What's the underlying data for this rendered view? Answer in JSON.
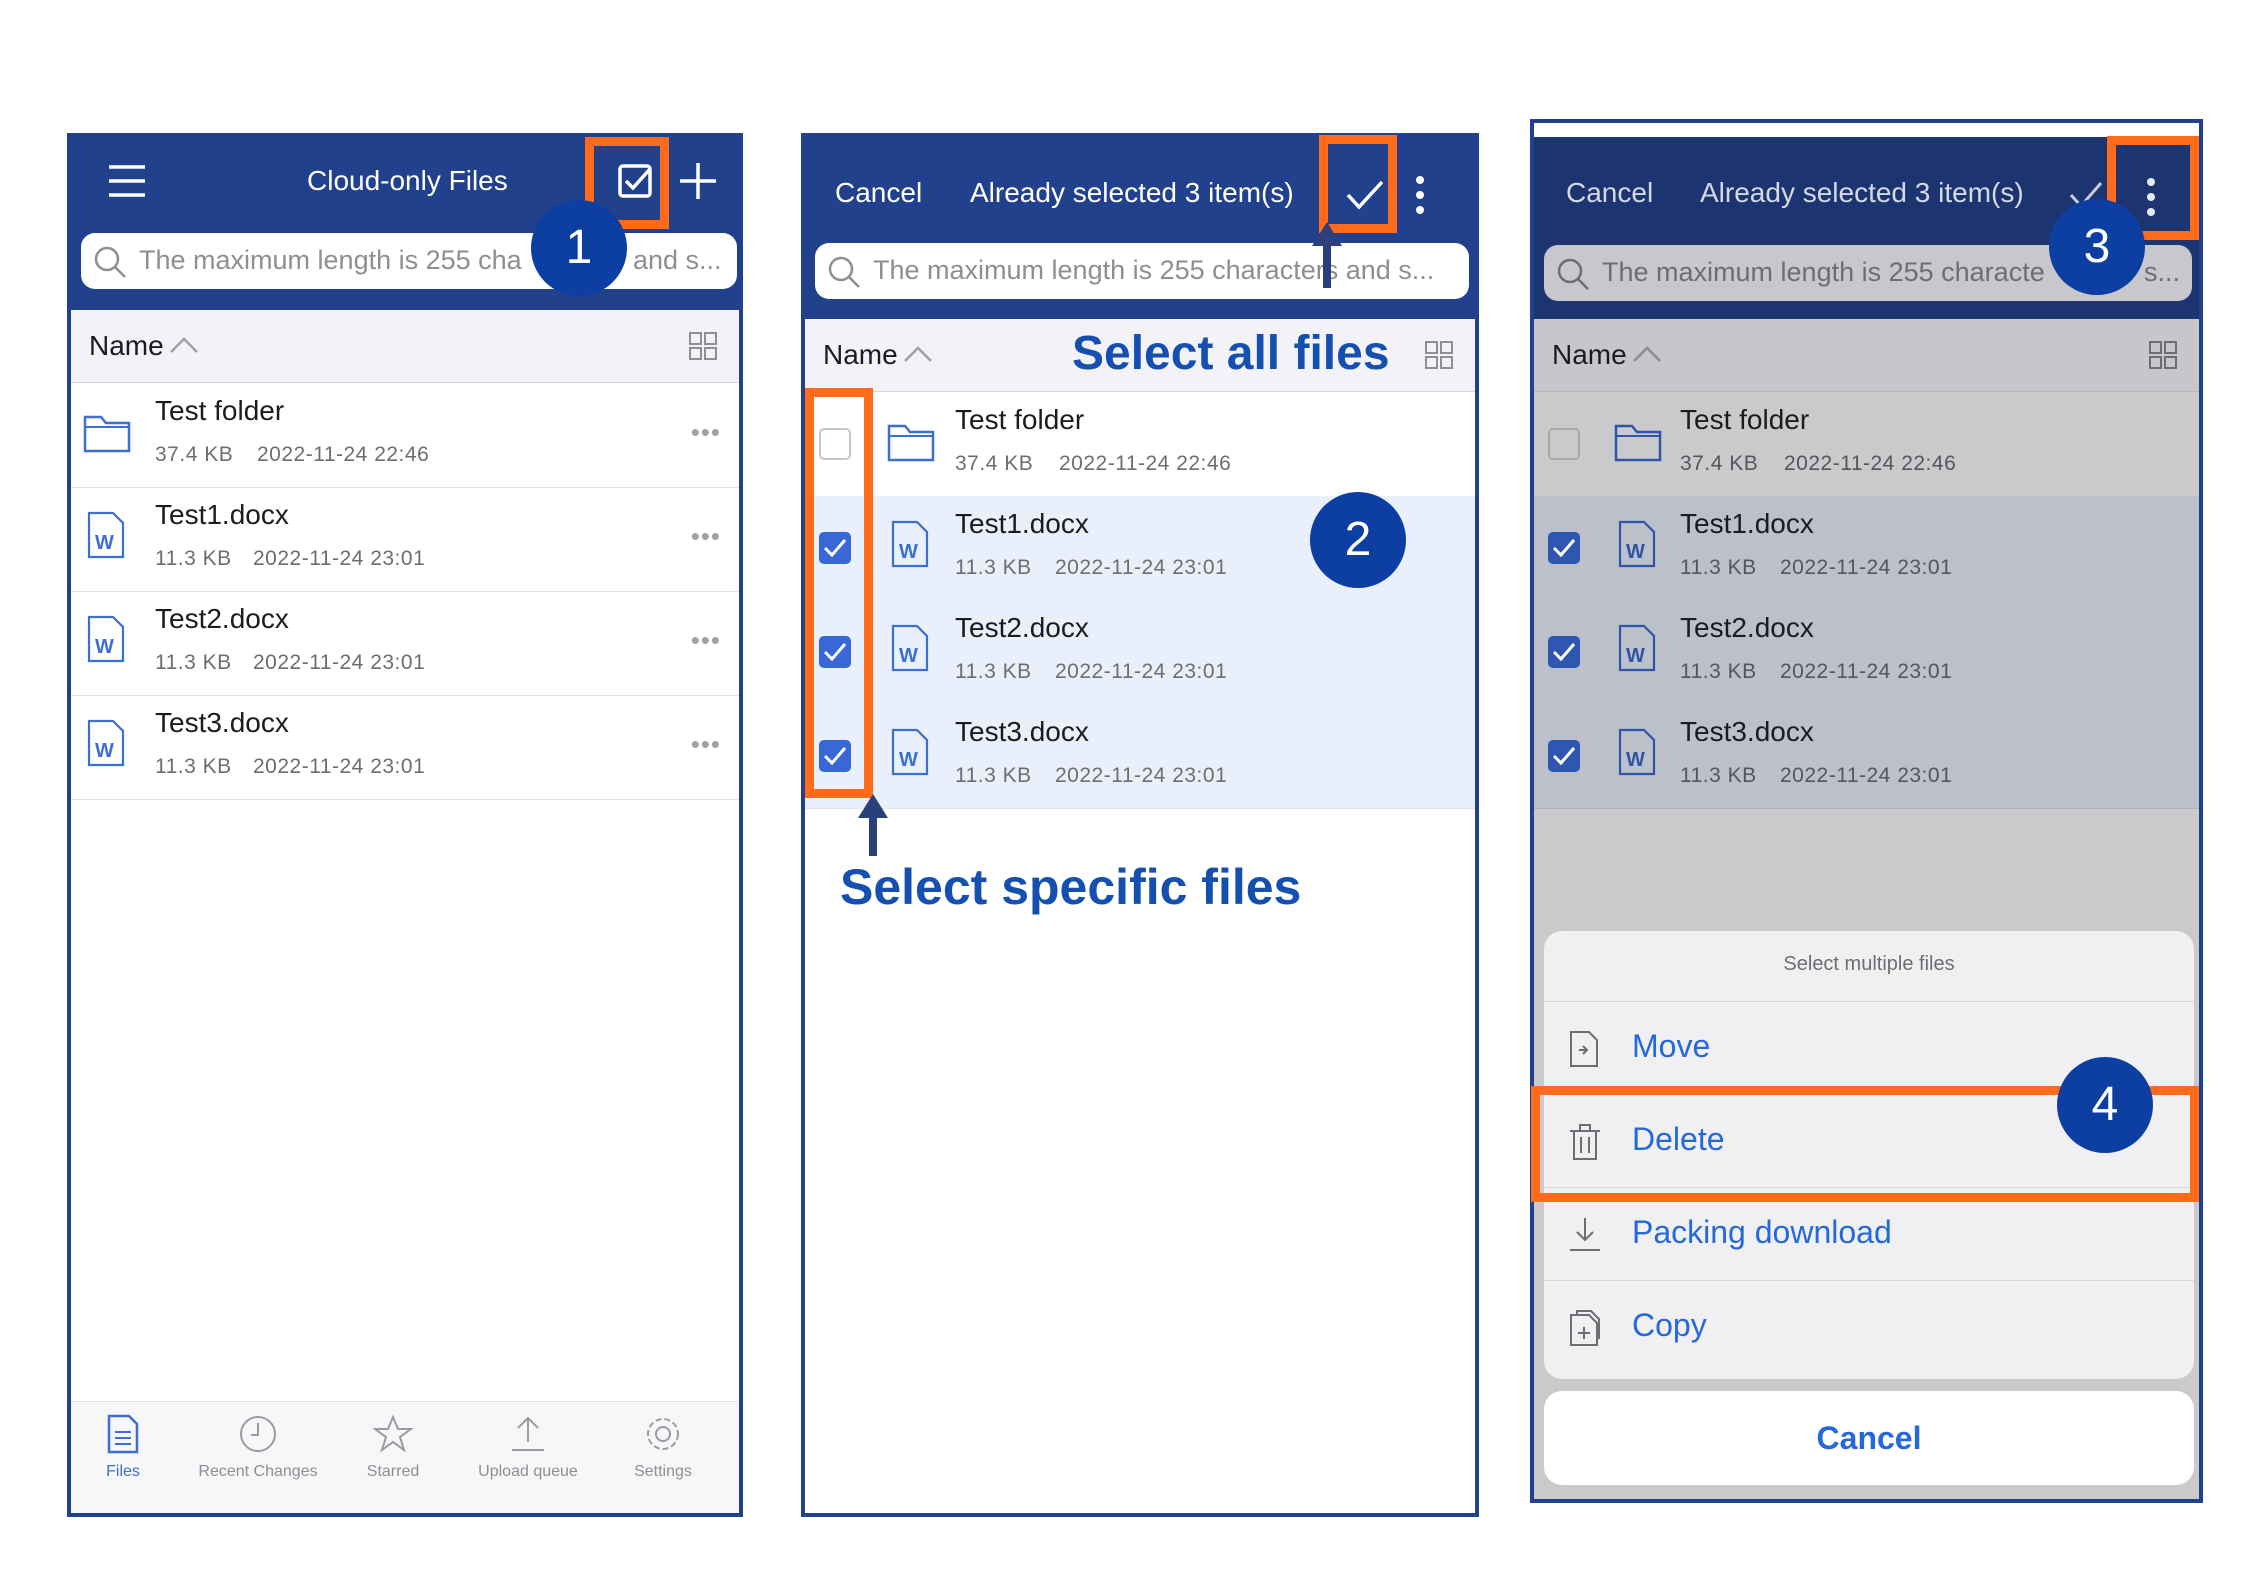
{
  "panel1": {
    "title": "Cloud-only Files",
    "search_placeholder": "The maximum length is 255 cha",
    "search_placeholder_tail": "and s...",
    "sort_label": "Name",
    "files": [
      {
        "name": "Test folder",
        "size": "37.4 KB",
        "date": "2022-11-24 22:46",
        "icon": "folder-icon"
      },
      {
        "name": "Test1.docx",
        "size": "11.3 KB",
        "date": "2022-11-24 23:01",
        "icon": "word-doc-icon"
      },
      {
        "name": "Test2.docx",
        "size": "11.3 KB",
        "date": "2022-11-24 23:01",
        "icon": "word-doc-icon"
      },
      {
        "name": "Test3.docx",
        "size": "11.3 KB",
        "date": "2022-11-24 23:01",
        "icon": "word-doc-icon"
      }
    ],
    "more_glyph": "•••",
    "tabs": [
      {
        "label": "Files",
        "icon": "files-icon",
        "active": true
      },
      {
        "label": "Recent Changes",
        "icon": "clock-icon",
        "active": false
      },
      {
        "label": "Starred",
        "icon": "star-icon",
        "active": false
      },
      {
        "label": "Upload queue",
        "icon": "upload-icon",
        "active": false
      },
      {
        "label": "Settings",
        "icon": "gear-icon",
        "active": false
      }
    ],
    "step_badge": "1"
  },
  "panel2": {
    "cancel": "Cancel",
    "title": "Already selected 3 item(s)",
    "search_placeholder": "The maximum length is 255 characters and s...",
    "sort_label": "Name",
    "files": [
      {
        "name": "Test folder",
        "size": "37.4 KB",
        "date": "2022-11-24 22:46",
        "checked": false
      },
      {
        "name": "Test1.docx",
        "size": "11.3 KB",
        "date": "2022-11-24 23:01",
        "checked": true
      },
      {
        "name": "Test2.docx",
        "size": "11.3 KB",
        "date": "2022-11-24 23:01",
        "checked": true
      },
      {
        "name": "Test3.docx",
        "size": "11.3 KB",
        "date": "2022-11-24 23:01",
        "checked": true
      }
    ],
    "annotation_select_all": "Select all files",
    "annotation_select_specific": "Select specific files",
    "step_badge": "2"
  },
  "panel3": {
    "cancel": "Cancel",
    "title": "Already selected 3 item(s)",
    "search_placeholder": "The maximum length is 255 characte",
    "search_placeholder_tail": "s...",
    "sort_label": "Name",
    "files": [
      {
        "name": "Test folder",
        "size": "37.4 KB",
        "date": "2022-11-24 22:46",
        "checked": false
      },
      {
        "name": "Test1.docx",
        "size": "11.3 KB",
        "date": "2022-11-24 23:01",
        "checked": true
      },
      {
        "name": "Test2.docx",
        "size": "11.3 KB",
        "date": "2022-11-24 23:01",
        "checked": true
      },
      {
        "name": "Test3.docx",
        "size": "11.3 KB",
        "date": "2022-11-24 23:01",
        "checked": true
      }
    ],
    "sheet": {
      "title": "Select multiple files",
      "actions": [
        {
          "label": "Move",
          "icon": "move-icon"
        },
        {
          "label": "Delete",
          "icon": "trash-icon"
        },
        {
          "label": "Packing download",
          "icon": "download-icon"
        },
        {
          "label": "Copy",
          "icon": "copy-icon"
        }
      ],
      "cancel": "Cancel"
    },
    "step_badge_3": "3",
    "step_badge_4": "4"
  },
  "colors": {
    "header": "#22418c",
    "highlight": "#ff6b1a",
    "badge": "#0d3fa3",
    "checkbox": "#3867d6",
    "link": "#2468d9"
  }
}
